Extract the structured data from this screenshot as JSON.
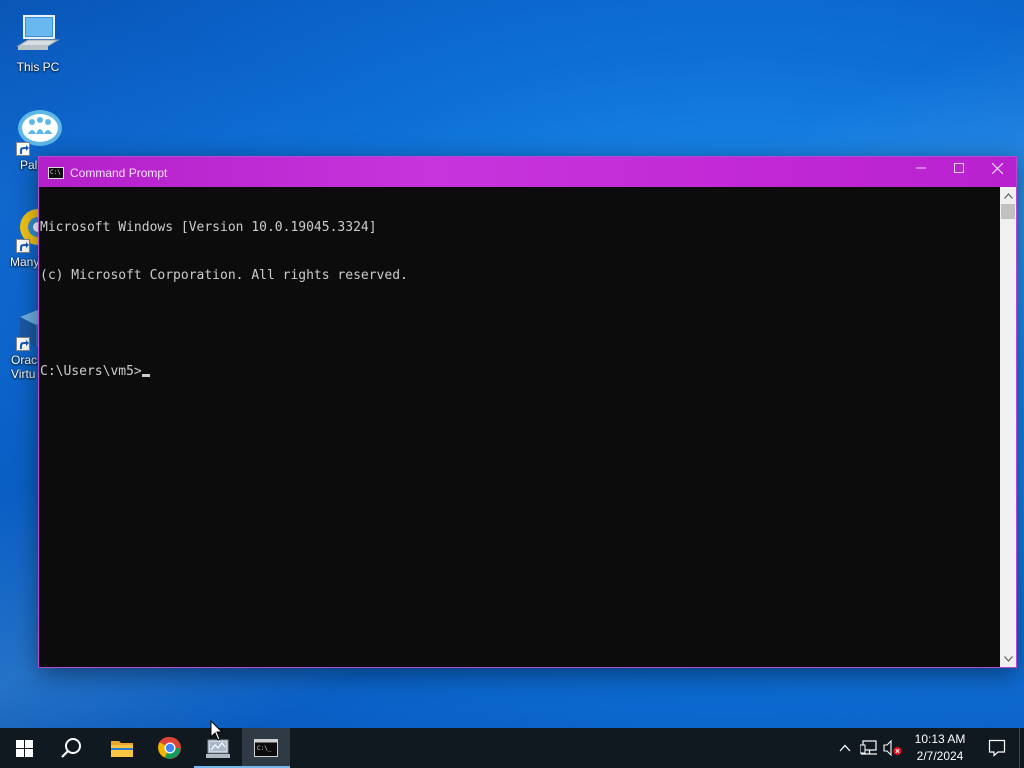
{
  "desktop": {
    "icons": [
      {
        "label": "This PC",
        "icon": "this-pc-icon"
      },
      {
        "label": "Pal",
        "icon": "paltalk-icon"
      },
      {
        "label": "Many",
        "icon": "manycam-icon"
      },
      {
        "label": "Oracl\nVirtu",
        "icon": "virtualbox-icon"
      }
    ]
  },
  "window": {
    "title": "Command Prompt",
    "accent_color": "#c12ad6",
    "console_lines": [
      "Microsoft Windows [Version 10.0.19045.3324]",
      "(c) Microsoft Corporation. All rights reserved.",
      "",
      "C:\\Users\\vm5>"
    ]
  },
  "taskbar": {
    "items": [
      {
        "name": "start-button",
        "icon": "windows-logo-icon"
      },
      {
        "name": "search-button",
        "icon": "search-icon"
      },
      {
        "name": "file-explorer",
        "icon": "folder-icon"
      },
      {
        "name": "chrome",
        "icon": "chrome-icon"
      },
      {
        "name": "network-app",
        "icon": "network-app-icon"
      },
      {
        "name": "command-prompt",
        "icon": "cmd-icon"
      }
    ],
    "clock": {
      "time": "10:13 AM",
      "date": "2/7/2024"
    }
  }
}
